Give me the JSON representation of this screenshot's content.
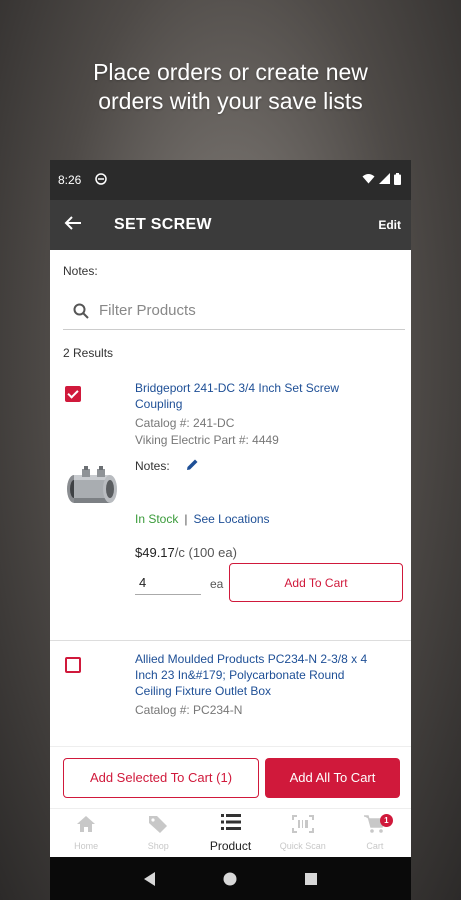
{
  "headline": {
    "line1": "Place orders or create new",
    "line2": "orders with your save lists"
  },
  "status_bar": {
    "time": "8:26"
  },
  "app_bar": {
    "title": "SET SCREW",
    "edit_label": "Edit"
  },
  "list": {
    "notes_label": "Notes:",
    "filter_placeholder": "Filter Products",
    "results_count": "2 Results"
  },
  "items": [
    {
      "checked": true,
      "title": "Bridgeport 241-DC 3/4 Inch Set Screw Coupling",
      "catalog": "Catalog #: 241-DC",
      "part": "Viking Electric Part #: 4449",
      "notes_label": "Notes:",
      "stock_status": "In Stock",
      "separator": "|",
      "see_locations": "See Locations",
      "price": "$49.17",
      "price_unit": "/c (100 ea)",
      "quantity": "4",
      "unit": "ea",
      "add_to_cart": "Add To Cart"
    },
    {
      "checked": false,
      "title": "Allied Moulded Products PC234-N 2-3/8 x 4 Inch 23 In&#179; Polycarbonate Round Ceiling Fixture Outlet Box",
      "catalog": "Catalog #: PC234-N"
    }
  ],
  "actions": {
    "add_selected": "Add Selected To Cart (1)",
    "add_all": "Add All To Cart"
  },
  "tabs": [
    {
      "label": "Home",
      "icon": "home-icon",
      "active": false
    },
    {
      "label": "Shop",
      "icon": "tag-icon",
      "active": false
    },
    {
      "label": "Product",
      "icon": "list-icon",
      "active": true
    },
    {
      "label": "Quick Scan",
      "icon": "scan-icon",
      "active": false
    },
    {
      "label": "Cart",
      "icon": "cart-icon",
      "active": false,
      "badge": "1"
    }
  ],
  "colors": {
    "accent": "#d0193b",
    "link": "#1e4f96",
    "in_stock": "#3a9b3a",
    "app_bar": "#3b3b3b"
  }
}
